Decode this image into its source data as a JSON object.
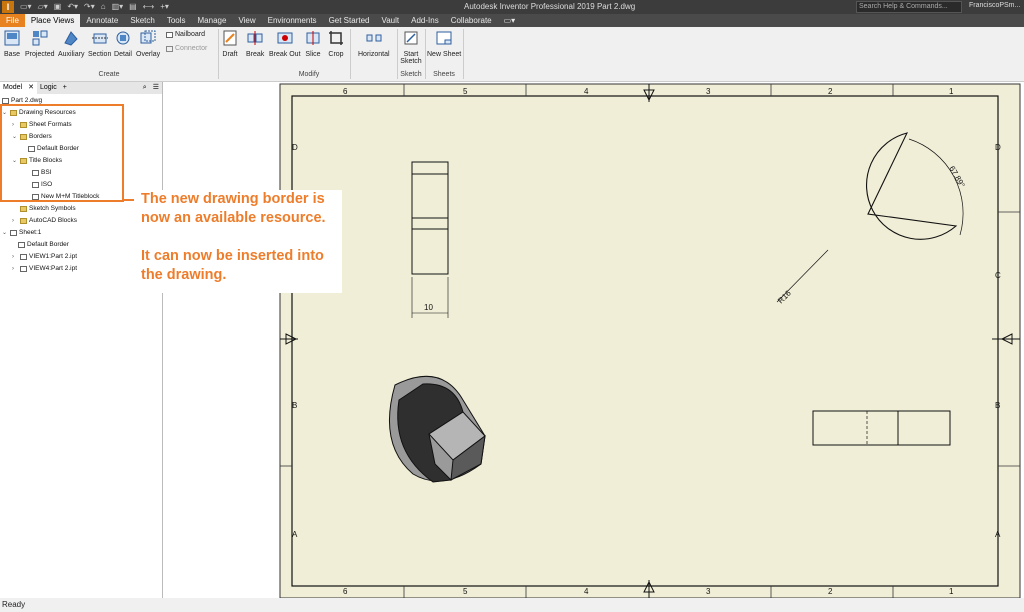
{
  "titlebar": {
    "logo": "I",
    "app_title": "Autodesk Inventor Professional 2019    Part 2.dwg",
    "search_placeholder": "Search Help & Commands...",
    "user": "FranciscoPSm..."
  },
  "tabs": [
    "File",
    "Place Views",
    "Annotate",
    "Sketch",
    "Tools",
    "Manage",
    "View",
    "Environments",
    "Get Started",
    "Vault",
    "Add-Ins",
    "Collaborate"
  ],
  "ribbon": {
    "create": [
      "Base",
      "Projected",
      "Auxiliary",
      "Section",
      "Detail",
      "Overlay"
    ],
    "nailboard": "Nailboard",
    "connector": "Connector",
    "create_label": "Create",
    "modify": [
      "Draft",
      "Break",
      "Break Out",
      "Slice",
      "Crop"
    ],
    "horizontal": "Horizontal",
    "modify_label": "Modify",
    "start_sketch": "Start Sketch",
    "sketch_label": "Sketch",
    "new_sheet": "New Sheet",
    "sheets_label": "Sheets"
  },
  "browser": {
    "tab_model": "Model",
    "tab_close": "✕",
    "tab_logic": "Logic",
    "tab_plus": "+",
    "nodes": [
      "Part 2.dwg",
      "Drawing Resources",
      "Sheet Formats",
      "Borders",
      "Default Border",
      "Title Blocks",
      "BSI",
      "ISO",
      "New M+M Titleblock",
      "Sketch Symbols",
      "AutoCAD Blocks",
      "Sheet:1",
      "Default Border",
      "VIEW1:Part 2.ipt",
      "VIEW4:Part 2.ipt"
    ]
  },
  "drawing": {
    "col_labels": [
      "6",
      "5",
      "4",
      "3",
      "2",
      "1"
    ],
    "row_labels": [
      "D",
      "C",
      "B",
      "A"
    ],
    "dim_width": "10",
    "dim_angle": "67.89°",
    "dim_radius": "R16",
    "sheet_color": "#f0eed7"
  },
  "callout": {
    "line1": "The new drawing border is now an available resource.",
    "line2": "It can now be inserted into the drawing.",
    "accent": "#ee7d2b"
  },
  "status": "Ready"
}
